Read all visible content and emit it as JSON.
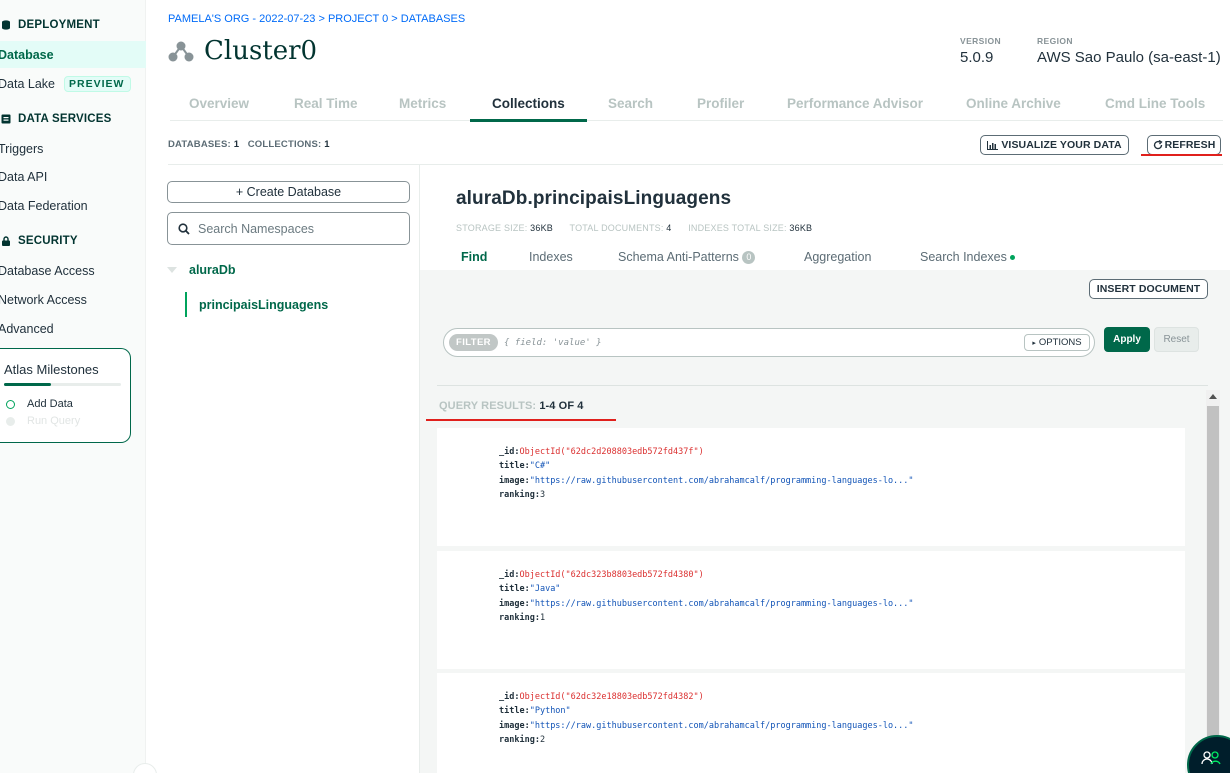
{
  "sidebar": {
    "sections": {
      "deployment": "DEPLOYMENT",
      "data_services": "DATA SERVICES",
      "security": "SECURITY"
    },
    "items": {
      "database": "Database",
      "data_lake": "Data Lake",
      "data_lake_badge": "PREVIEW",
      "triggers": "Triggers",
      "data_api": "Data API",
      "data_federation": "Data Federation",
      "database_access": "Database Access",
      "network_access": "Network Access",
      "advanced": "Advanced"
    },
    "milestones": {
      "title": "Atlas Milestones",
      "progress": 0.4,
      "steps": [
        "Add Data",
        "Run Query"
      ]
    }
  },
  "header": {
    "breadcrumb": "PAMELA'S ORG - 2022-07-23 > PROJECT 0 > DATABASES",
    "cluster_name": "Cluster0",
    "version_label": "VERSION",
    "version": "5.0.9",
    "region_label": "REGION",
    "region": "AWS Sao Paulo (sa-east-1)"
  },
  "tabs": [
    "Overview",
    "Real Time",
    "Metrics",
    "Collections",
    "Search",
    "Profiler",
    "Performance Advisor",
    "Online Archive",
    "Cmd Line Tools"
  ],
  "active_tab": "Collections",
  "counts": {
    "databases_label": "DATABASES:",
    "databases": "1",
    "collections_label": "COLLECTIONS:",
    "collections": "1"
  },
  "buttons": {
    "visualize": "VISUALIZE YOUR DATA",
    "refresh": "REFRESH",
    "create_db": "+ Create Database",
    "insert_doc": "INSERT DOCUMENT",
    "apply": "Apply",
    "reset": "Reset",
    "options": "OPTIONS"
  },
  "namespace": {
    "search_placeholder": "Search Namespaces",
    "db_name": "aluraDb",
    "collection_name": "principaisLinguagens"
  },
  "collection": {
    "title": "aluraDb.principaisLinguagens",
    "storage_label": "STORAGE SIZE:",
    "storage": "36KB",
    "total_docs_label": "TOTAL DOCUMENTS:",
    "total_docs": "4",
    "indexes_label": "INDEXES TOTAL SIZE:",
    "indexes_size": "36KB",
    "subtabs": {
      "find": "Find",
      "indexes": "Indexes",
      "schema": "Schema Anti-Patterns",
      "schema_count": "0",
      "aggregation": "Aggregation",
      "search_indexes": "Search Indexes"
    }
  },
  "filter": {
    "chip": "FILTER",
    "placeholder": "{ field: 'value' }"
  },
  "results": {
    "label": "QUERY RESULTS:",
    "range": "1-4 OF 4"
  },
  "documents": [
    {
      "id_key": "_id:",
      "id": "ObjectId(\"62dc2d208803edb572fd437f\")",
      "title_key": "title:",
      "title": "\"C#\"",
      "image_key": "image:",
      "image": "\"https://raw.githubusercontent.com/abrahamcalf/programming-languages-lo...\"",
      "ranking_key": "ranking:",
      "ranking": "3"
    },
    {
      "id_key": "_id:",
      "id": "ObjectId(\"62dc323b8803edb572fd4380\")",
      "title_key": "title:",
      "title": "\"Java\"",
      "image_key": "image:",
      "image": "\"https://raw.githubusercontent.com/abrahamcalf/programming-languages-lo...\"",
      "ranking_key": "ranking:",
      "ranking": "1"
    },
    {
      "id_key": "_id:",
      "id": "ObjectId(\"62dc32e18803edb572fd4382\")",
      "title_key": "title:",
      "title": "\"Python\"",
      "image_key": "image:",
      "image": "\"https://raw.githubusercontent.com/abrahamcalf/programming-languages-lo...\"",
      "ranking_key": "ranking:",
      "ranking": "2"
    }
  ],
  "colors": {
    "brand_green": "#00684a",
    "accent_green": "#00a35c",
    "annotation_red": "#e0201c"
  }
}
